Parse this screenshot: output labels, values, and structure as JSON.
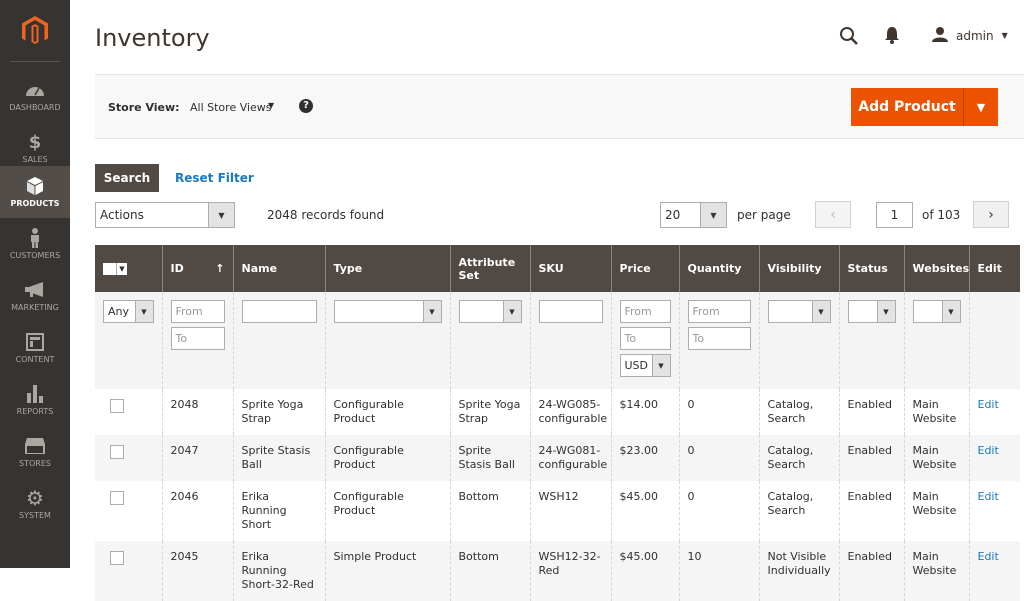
{
  "sidebar": {
    "items": [
      {
        "label": "Dashboard",
        "icon": "dashboard-icon"
      },
      {
        "label": "Sales",
        "icon": "dollar-icon"
      },
      {
        "label": "Products",
        "icon": "box-icon",
        "active": true
      },
      {
        "label": "Customers",
        "icon": "person-icon"
      },
      {
        "label": "Marketing",
        "icon": "megaphone-icon"
      },
      {
        "label": "Content",
        "icon": "layout-icon"
      },
      {
        "label": "Reports",
        "icon": "bar-chart-icon"
      },
      {
        "label": "Stores",
        "icon": "store-icon"
      },
      {
        "label": "System",
        "icon": "gear-icon"
      }
    ]
  },
  "header": {
    "title": "Inventory",
    "user": "admin"
  },
  "store_view": {
    "label": "Store View:",
    "value": "All Store Views"
  },
  "add_product": {
    "label": "Add Product"
  },
  "filters": {
    "search_label": "Search",
    "reset_label": "Reset Filter"
  },
  "actions": {
    "value": "Actions"
  },
  "records": "2048 records found",
  "pagination": {
    "per_page_value": "20",
    "per_page_label": "per page",
    "current_page": "1",
    "total_label": "of 103"
  },
  "table": {
    "columns": [
      "ID",
      "Name",
      "Type",
      "Attribute Set",
      "SKU",
      "Price",
      "Quantity",
      "Visibility",
      "Status",
      "Websites",
      "Edit"
    ],
    "filters": {
      "mass_select": "Any",
      "from": "From",
      "to": "To",
      "currency": "USD"
    },
    "rows": [
      {
        "id": "2048",
        "name": "Sprite Yoga Strap",
        "type": "Configurable Product",
        "attr_set": "Sprite Yoga Strap",
        "sku": "24-WG085-configurable",
        "price": "$14.00",
        "qty": "0",
        "visibility": "Catalog, Search",
        "status": "Enabled",
        "websites": "Main Website",
        "edit": "Edit"
      },
      {
        "id": "2047",
        "name": "Sprite Stasis Ball",
        "type": "Configurable Product",
        "attr_set": "Sprite Stasis Ball",
        "sku": "24-WG081-configurable",
        "price": "$23.00",
        "qty": "0",
        "visibility": "Catalog, Search",
        "status": "Enabled",
        "websites": "Main Website",
        "edit": "Edit"
      },
      {
        "id": "2046",
        "name": "Erika Running Short",
        "type": "Configurable Product",
        "attr_set": "Bottom",
        "sku": "WSH12",
        "price": "$45.00",
        "qty": "0",
        "visibility": "Catalog, Search",
        "status": "Enabled",
        "websites": "Main Website",
        "edit": "Edit"
      },
      {
        "id": "2045",
        "name": "Erika Running Short-32-Red",
        "type": "Simple Product",
        "attr_set": "Bottom",
        "sku": "WSH12-32-Red",
        "price": "$45.00",
        "qty": "10",
        "visibility": "Not Visible Individually",
        "status": "Enabled",
        "websites": "Main Website",
        "edit": "Edit"
      }
    ]
  },
  "colors": {
    "accent": "#eb5202",
    "sidebar_bg": "#373330",
    "header_bg": "#514943",
    "link": "#1979c3"
  }
}
